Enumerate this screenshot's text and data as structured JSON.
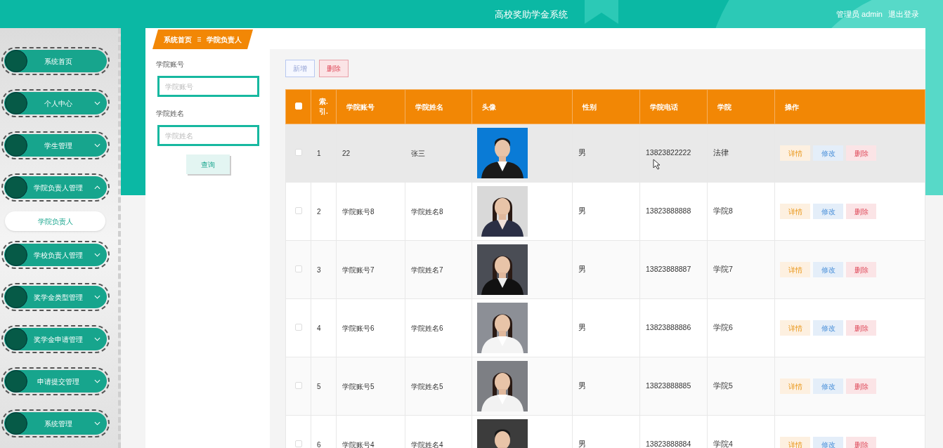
{
  "header": {
    "title": "高校奖助学金系统",
    "user": "管理员 admin",
    "logout": "退出登录"
  },
  "sidebar": {
    "items": [
      {
        "label": "系统首页",
        "kind": "link"
      },
      {
        "label": "个人中心",
        "kind": "menu",
        "expanded": false
      },
      {
        "label": "学生管理",
        "kind": "menu",
        "expanded": false
      },
      {
        "label": "学院负责人管理",
        "kind": "menu",
        "expanded": true,
        "children": [
          {
            "label": "学院负责人",
            "selected": true
          }
        ]
      },
      {
        "label": "学校负责人管理",
        "kind": "menu",
        "expanded": false
      },
      {
        "label": "奖学金类型管理",
        "kind": "menu",
        "expanded": false
      },
      {
        "label": "奖学金申请管理",
        "kind": "menu",
        "expanded": false
      },
      {
        "label": "申请提交管理",
        "kind": "menu",
        "expanded": false
      },
      {
        "label": "系统管理",
        "kind": "menu",
        "expanded": false
      }
    ]
  },
  "breadcrumb": [
    "系统首页",
    "学院负责人"
  ],
  "search": {
    "fields": [
      {
        "label": "学院账号",
        "placeholder": "学院账号"
      },
      {
        "label": "学院姓名",
        "placeholder": "学院姓名"
      }
    ],
    "button": "查询"
  },
  "toolbar": [
    {
      "label": "新增",
      "kind": "add"
    },
    {
      "label": "删除",
      "kind": "delete"
    }
  ],
  "table": {
    "select_all_checked": false,
    "columns": [
      "索.引.",
      "学院账号",
      "学院姓名",
      "头像",
      "性别",
      "学院电话",
      "学院",
      "操作"
    ],
    "rows": [
      {
        "checked": false,
        "hovered": true,
        "index": "1",
        "account": "22",
        "name": "张三",
        "gender": "男",
        "phone": "13823822222",
        "college": "法律",
        "actions": [
          "详情",
          "修改",
          "删除"
        ]
      },
      {
        "checked": false,
        "hovered": false,
        "index": "2",
        "account": "学院账号8",
        "name": "学院姓名8",
        "gender": "男",
        "phone": "13823888888",
        "college": "学院8",
        "actions": [
          "详情",
          "修改",
          "删除"
        ]
      },
      {
        "checked": false,
        "hovered": false,
        "index": "3",
        "account": "学院账号7",
        "name": "学院姓名7",
        "gender": "男",
        "phone": "13823888887",
        "college": "学院7",
        "actions": [
          "详情",
          "修改",
          "删除"
        ]
      },
      {
        "checked": false,
        "hovered": false,
        "index": "4",
        "account": "学院账号6",
        "name": "学院姓名6",
        "gender": "男",
        "phone": "13823888886",
        "college": "学院6",
        "actions": [
          "详情",
          "修改",
          "删除"
        ]
      },
      {
        "checked": false,
        "hovered": false,
        "index": "5",
        "account": "学院账号5",
        "name": "学院姓名5",
        "gender": "男",
        "phone": "13823888885",
        "college": "学院5",
        "actions": [
          "详情",
          "修改",
          "删除"
        ]
      },
      {
        "checked": false,
        "hovered": false,
        "index": "6",
        "account": "学院账号4",
        "name": "学院姓名4",
        "gender": "男",
        "phone": "13823888884",
        "college": "学院4",
        "actions": [
          "详情",
          "修改",
          "删除"
        ]
      }
    ]
  }
}
